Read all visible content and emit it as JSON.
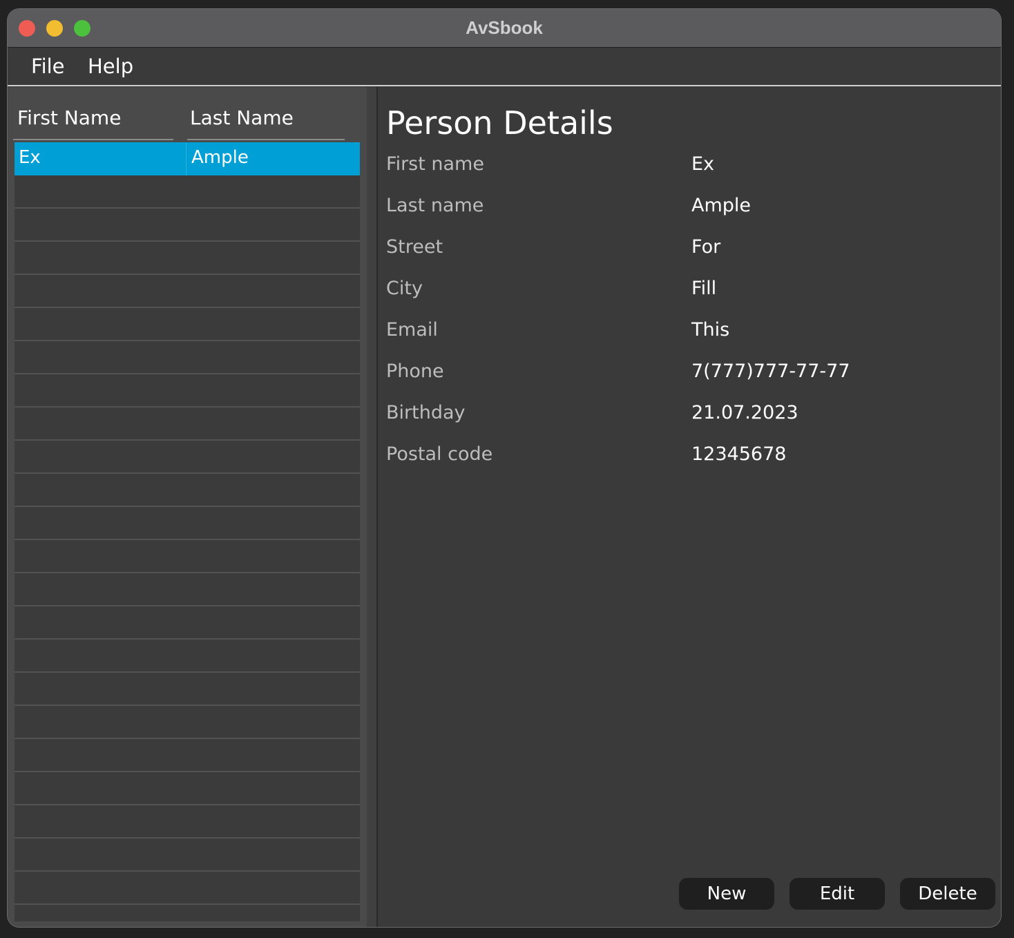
{
  "window": {
    "title": "AvSbook"
  },
  "menu": {
    "file": "File",
    "help": "Help"
  },
  "table": {
    "columns": [
      "First Name",
      "Last Name"
    ],
    "rows": [
      {
        "first": "Ex",
        "last": "Ample",
        "selected": true
      }
    ]
  },
  "details": {
    "title": "Person Details",
    "fields": [
      {
        "label": "First name",
        "value": "Ex"
      },
      {
        "label": "Last name",
        "value": "Ample"
      },
      {
        "label": "Street",
        "value": "For"
      },
      {
        "label": "City",
        "value": "Fill"
      },
      {
        "label": "Email",
        "value": "This"
      },
      {
        "label": "Phone",
        "value": "7(777)777-77-77"
      },
      {
        "label": "Birthday",
        "value": "21.07.2023"
      },
      {
        "label": "Postal code",
        "value": "12345678"
      }
    ]
  },
  "buttons": {
    "new": "New",
    "edit": "Edit",
    "delete": "Delete"
  },
  "colors": {
    "selection": "#009fd6",
    "close": "#ee5c53",
    "minimize": "#f3bd31",
    "zoom": "#4cc13d"
  }
}
